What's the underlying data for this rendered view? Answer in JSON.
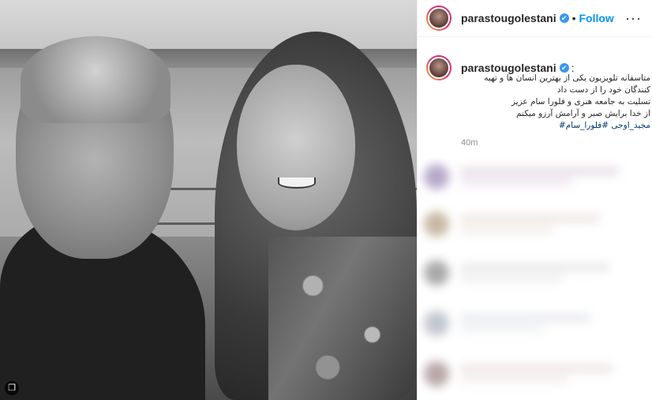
{
  "post": {
    "username": "parastougolestani",
    "verified_glyph": "✔",
    "dot": "•",
    "follow_label": "Follow",
    "more_icon": "more-options-icon",
    "more_glyph": "···"
  },
  "caption": {
    "username": "parastougolestani",
    "colon": ":",
    "lines": [
      "متاسفانه تلویزیون یکی از بهترین انسان ها و تهیه",
      "کنندگان خود را از دست داد",
      "تسلیت به جامعه هنری و فلورا سام عزیز",
      "از خدا برایش صبر و آرامش آرزو میکنم"
    ],
    "tags": "مجید_اوجی #فلورا_سام#",
    "time": "40m"
  },
  "photo": {
    "multiple_icon": "multiple-photos-icon"
  },
  "colors": {
    "follow": "#0095f6",
    "verified": "#3897f0",
    "hashtag": "#00376b",
    "muted": "#8e8e8e"
  }
}
